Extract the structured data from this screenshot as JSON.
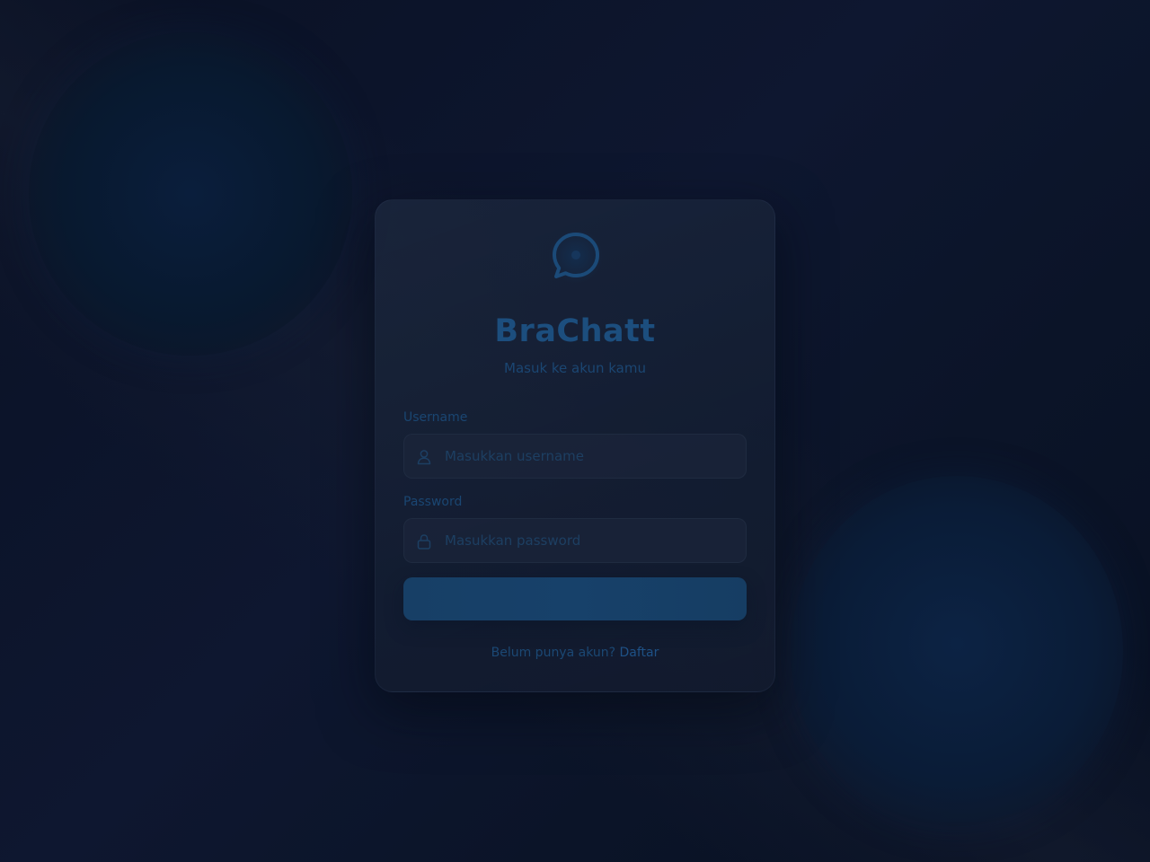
{
  "brand": {
    "title": "BraChatt",
    "subtitle": "Masuk ke akun kamu",
    "logo_icon": "chat-bubble-icon"
  },
  "form": {
    "username": {
      "label": "Username",
      "placeholder": "Masukkan username",
      "value": "",
      "icon": "user-icon"
    },
    "password": {
      "label": "Password",
      "placeholder": "Masukkan password",
      "value": "",
      "icon": "lock-icon"
    },
    "submit_label": ""
  },
  "signup": {
    "prompt": "Belum punya akun?",
    "link_label": "Daftar"
  },
  "colors": {
    "accent": "#1c4e7e",
    "button": "#17416a",
    "background": "#0b1428",
    "card": "#1a2640"
  }
}
